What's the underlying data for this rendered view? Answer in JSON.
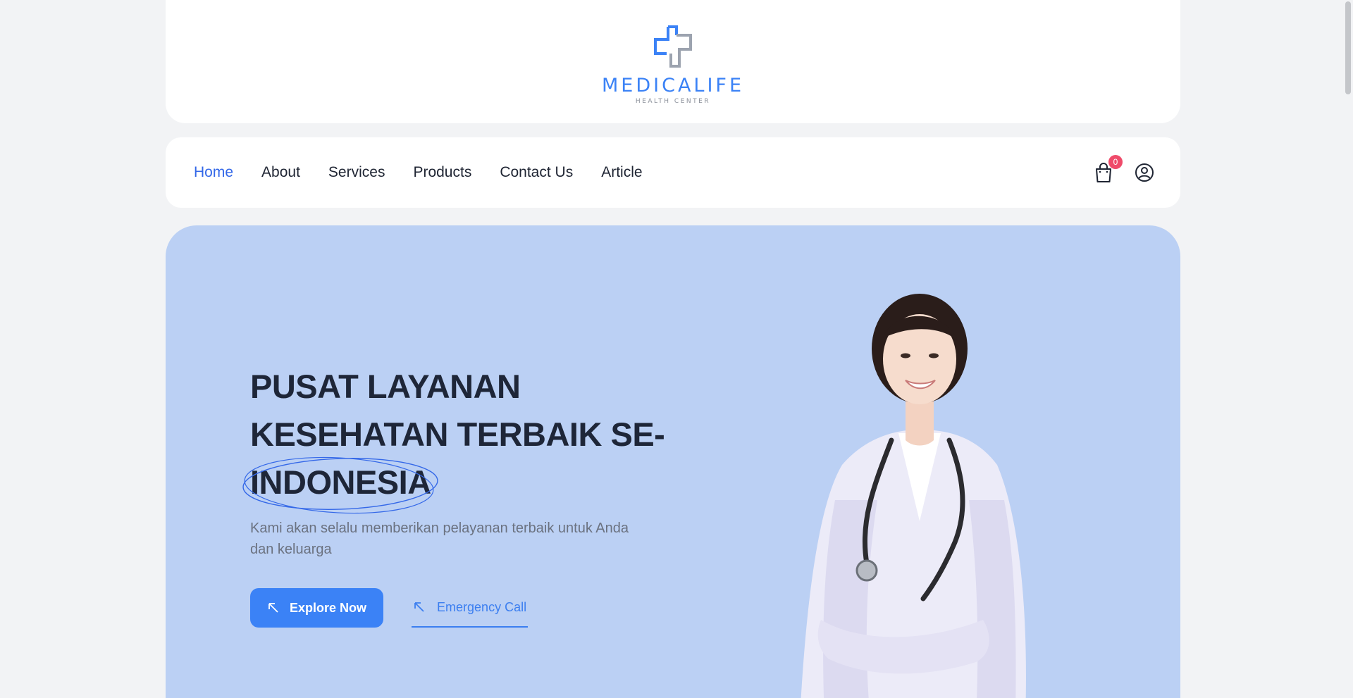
{
  "brand": {
    "name": "MEDICALIFE",
    "tagline": "HEALTH CENTER",
    "primary_color": "#3b82f6",
    "secondary_color": "#9ca3af"
  },
  "nav": {
    "items": [
      {
        "label": "Home",
        "active": true
      },
      {
        "label": "About",
        "active": false
      },
      {
        "label": "Services",
        "active": false
      },
      {
        "label": "Products",
        "active": false
      },
      {
        "label": "Contact Us",
        "active": false
      },
      {
        "label": "Article",
        "active": false
      }
    ],
    "cart_icon": "shopping-bag-icon",
    "cart_count": "0",
    "account_icon": "user-circle-icon"
  },
  "hero": {
    "title_line1": "PUSAT LAYANAN",
    "title_line2": "KESEHATAN TERBAIK SE-",
    "title_highlight": "INDONESIA",
    "subtitle": "Kami akan selalu memberikan pelayanan terbaik untuk Anda dan keluarga",
    "primary_button": "Explore Now",
    "secondary_button": "Emergency Call",
    "button_icon": "arrow-up-left-icon",
    "background_color": "#bbd0f4"
  }
}
